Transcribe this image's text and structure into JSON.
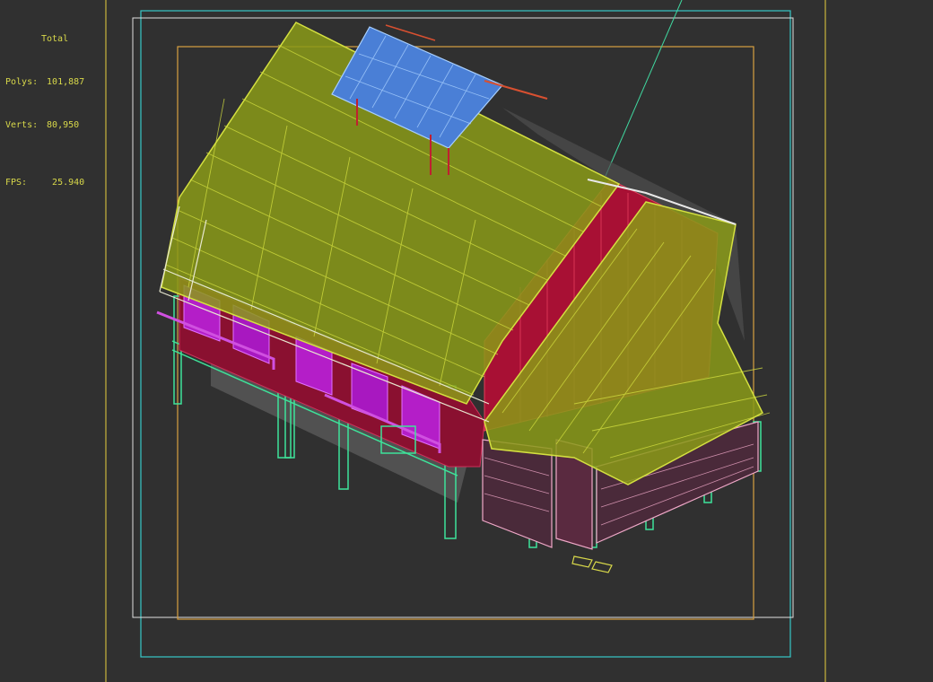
{
  "viewport": {
    "background": "#303030",
    "render_mode": "wireframe"
  },
  "stats": {
    "title": "Total",
    "polys_label": "Polys:",
    "polys_value": "101,887",
    "verts_label": "Verts:",
    "verts_value": "80,950",
    "fps_label": "FPS:",
    "fps_value": "25.940",
    "color": "#d8d84a"
  },
  "model": {
    "subject": "stilted wooden house with thatched roof",
    "colors": {
      "roof": "#9aa81c",
      "roof_wire": "#c8d838",
      "skylight": "#4a7fd6",
      "walls": "#b0103a",
      "walls_purple": "#b41ec8",
      "posts": "#3ee39a",
      "lower_walls": "#f0a8c8",
      "shadow": "#6a6a6a"
    }
  },
  "frames": {
    "safe_frame_outer_color": "#c8b43c",
    "safe_frame_cyan_color": "#38c8c8",
    "safe_frame_orange_color": "#d8a040",
    "light_line_color": "#40d8a0"
  }
}
